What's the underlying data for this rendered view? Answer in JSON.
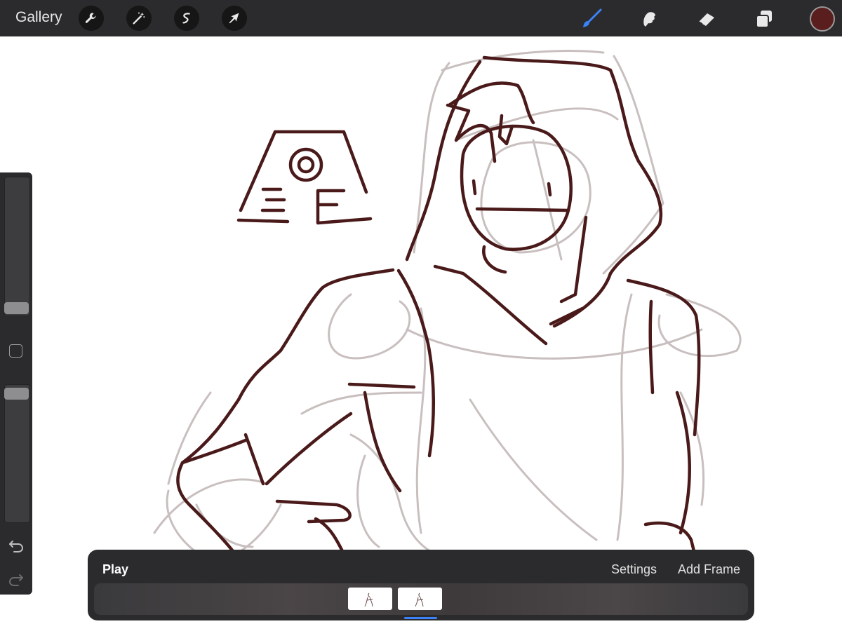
{
  "topbar": {
    "gallery_label": "Gallery",
    "left_tools": [
      "wrench-icon",
      "magic-wand-icon",
      "selection-icon",
      "transform-arrow-icon"
    ],
    "right_tools": [
      "brush-icon",
      "smudge-icon",
      "eraser-icon",
      "layers-icon"
    ],
    "active_tool": "brush",
    "active_tool_color": "#3b82f6",
    "current_color": "#5a1e1e"
  },
  "sidebar": {
    "brush_size": 0.06,
    "opacity": 1.0,
    "icons": [
      "modify-square-icon",
      "undo-icon",
      "redo-icon"
    ]
  },
  "animation": {
    "play_label": "Play",
    "settings_label": "Settings",
    "add_frame_label": "Add Frame",
    "frames": [
      "frame-1",
      "frame-2"
    ],
    "selected_frame": 2
  },
  "canvas": {
    "stroke_color": "#4a1a1a",
    "onion_skin_color": "#c9bfbf"
  }
}
